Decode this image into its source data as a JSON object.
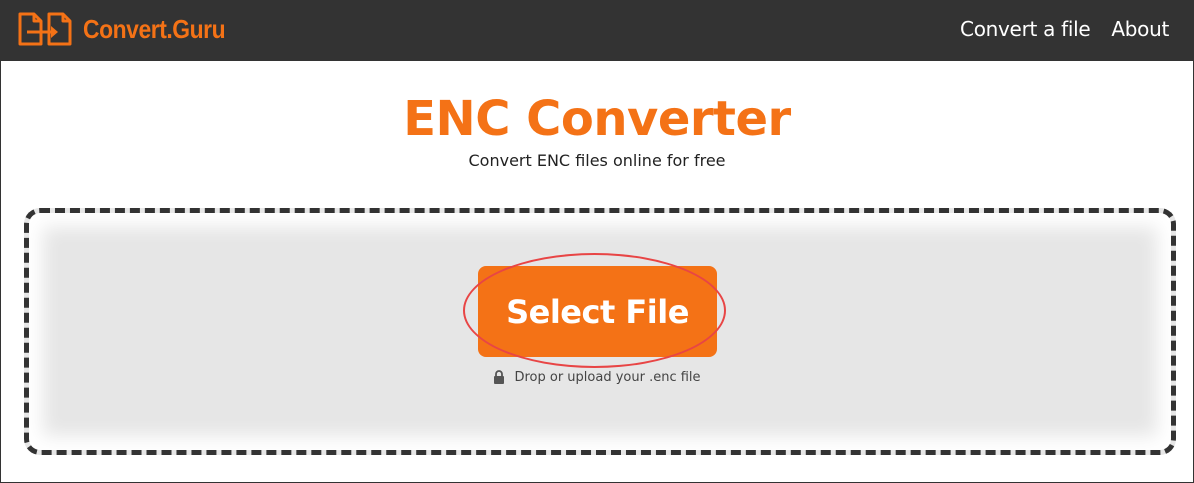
{
  "nav": {
    "brand": "Convert.Guru",
    "links": [
      "Convert a file",
      "About"
    ],
    "logo_icon": "convert-arrows-logo",
    "brand_color": "#f47216",
    "background": "#333333"
  },
  "hero": {
    "title": "ENC Converter",
    "subtitle": "Convert ENC files online for free"
  },
  "dropzone": {
    "button_label": "Select File",
    "hint": "Drop or upload your .enc file",
    "hint_icon": "lock-icon",
    "button_color": "#f47216",
    "highlight_color": "#e84545"
  }
}
